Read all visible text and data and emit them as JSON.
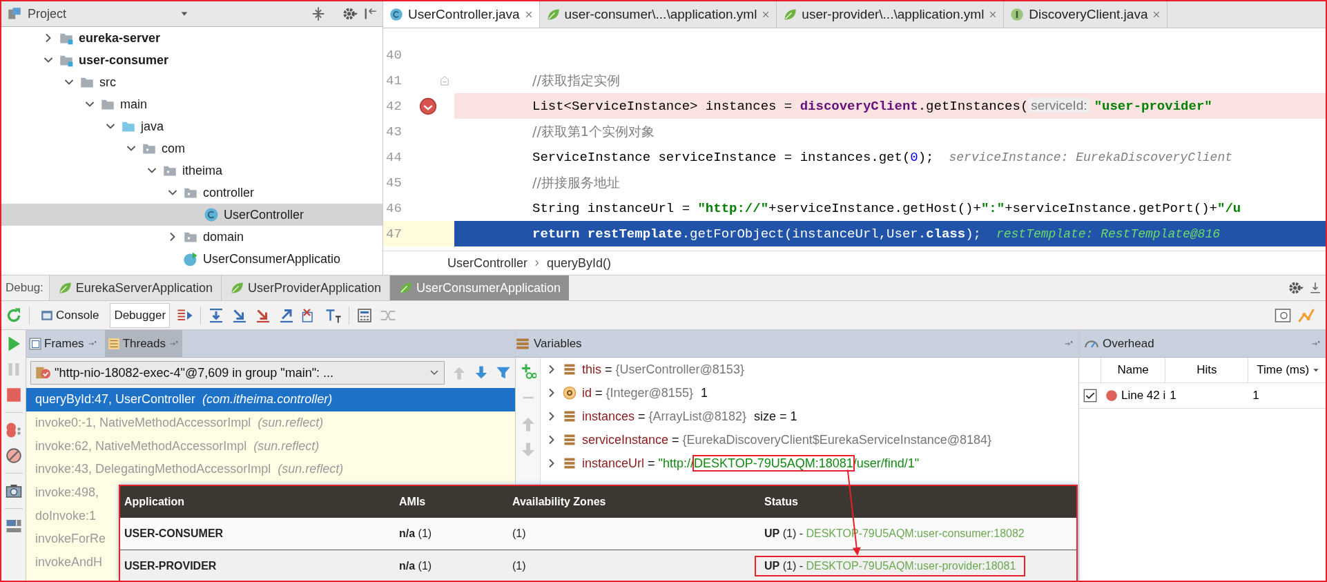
{
  "project": {
    "title": "Project",
    "tree": [
      {
        "label": "eureka-server",
        "kind": "module",
        "expanded": false,
        "selected": false
      },
      {
        "label": "user-consumer",
        "kind": "module",
        "expanded": true,
        "selected": false,
        "children": [
          {
            "label": "src",
            "kind": "folder",
            "expanded": true,
            "selected": false,
            "children": [
              {
                "label": "main",
                "kind": "folder",
                "expanded": true,
                "selected": false,
                "children": [
                  {
                    "label": "java",
                    "kind": "source_folder",
                    "expanded": true,
                    "selected": false,
                    "children": [
                      {
                        "label": "com",
                        "kind": "package",
                        "expanded": true,
                        "selected": false,
                        "children": [
                          {
                            "label": "itheima",
                            "kind": "package",
                            "expanded": true,
                            "selected": false,
                            "children": [
                              {
                                "label": "controller",
                                "kind": "package",
                                "expanded": true,
                                "selected": false,
                                "children": [
                                  {
                                    "label": "UserController",
                                    "kind": "class",
                                    "selected": true
                                  }
                                ]
                              },
                              {
                                "label": "domain",
                                "kind": "package",
                                "expanded": false,
                                "selected": false
                              },
                              {
                                "label": "UserConsumerApplicatio",
                                "kind": "main_class",
                                "selected": false
                              }
                            ]
                          }
                        ]
                      }
                    ]
                  }
                ]
              }
            ]
          }
        ]
      }
    ]
  },
  "editor": {
    "tabs": [
      {
        "label": "UserController.java",
        "kind": "class",
        "selected": true
      },
      {
        "label": "user-consumer\\...\\application.yml",
        "kind": "yml",
        "selected": false
      },
      {
        "label": "user-provider\\...\\application.yml",
        "kind": "yml",
        "selected": false
      },
      {
        "label": "DiscoveryClient.java",
        "kind": "interface",
        "selected": false
      }
    ],
    "lines": [
      {
        "number": "40",
        "kind": "normal"
      },
      {
        "number": "41",
        "kind": "normal",
        "tokens": [
          {
            "kind": "comment",
            "text": "//获取指定实例"
          }
        ]
      },
      {
        "number": "42",
        "kind": "breakpoint",
        "tokens": [
          {
            "kind": "plain",
            "text": "List<ServiceInstance> instances = "
          },
          {
            "kind": "field",
            "text": "discoveryClient"
          },
          {
            "kind": "plain",
            "text": ".getInstances("
          },
          {
            "kind": "hint",
            "text": "serviceId:"
          },
          {
            "kind": "string",
            "text": "\"user-provider\""
          }
        ]
      },
      {
        "number": "43",
        "kind": "normal",
        "tokens": [
          {
            "kind": "comment",
            "text": "//获取第1个实例对象"
          }
        ]
      },
      {
        "number": "44",
        "kind": "normal",
        "tokens": [
          {
            "kind": "plain",
            "text": "ServiceInstance serviceInstance = instances.get("
          },
          {
            "kind": "number",
            "text": "0"
          },
          {
            "kind": "plain",
            "text": ");"
          },
          {
            "kind": "inline_value",
            "text": "serviceInstance: EurekaDiscoveryClient"
          }
        ]
      },
      {
        "number": "45",
        "kind": "normal",
        "tokens": [
          {
            "kind": "comment",
            "text": "//拼接服务地址"
          }
        ]
      },
      {
        "number": "46",
        "kind": "normal",
        "tokens": [
          {
            "kind": "plain",
            "text": "String instanceUrl = "
          },
          {
            "kind": "string",
            "text": "\"http://\""
          },
          {
            "kind": "plain",
            "text": "+serviceInstance.getHost()+"
          },
          {
            "kind": "string",
            "text": "\":\""
          },
          {
            "kind": "plain",
            "text": "+serviceInstance.getPort()+"
          },
          {
            "kind": "string",
            "text": "\"/u"
          }
        ]
      },
      {
        "number": "47",
        "kind": "execution",
        "tokens": [
          {
            "kind": "keyword",
            "text": "return "
          },
          {
            "kind": "field",
            "text": "restTemplate"
          },
          {
            "kind": "plain",
            "text": ".getForObject(instanceUrl,User."
          },
          {
            "kind": "keyword",
            "text": "class"
          },
          {
            "kind": "plain",
            "text": ");"
          },
          {
            "kind": "inline_value",
            "text": "restTemplate: RestTemplate@816"
          }
        ]
      }
    ],
    "breadcrumb": [
      "UserController",
      "queryById()"
    ]
  },
  "debug": {
    "label": "Debug:",
    "run_tabs": [
      {
        "label": "EurekaServerApplication",
        "selected": false
      },
      {
        "label": "UserProviderApplication",
        "selected": false
      },
      {
        "label": "UserConsumerApplication",
        "selected": true
      }
    ],
    "view_tabs": [
      {
        "label": "Console",
        "kind": "console",
        "selected": false
      },
      {
        "label": "Debugger",
        "kind": "debugger",
        "selected": true
      }
    ],
    "frames": {
      "tabs": [
        {
          "label": "Frames",
          "selected": false
        },
        {
          "label": "Threads",
          "selected": true
        }
      ],
      "thread": "\"http-nio-18082-exec-4\"@7,609 in group \"main\": ...",
      "items": [
        {
          "method": "queryById:47, UserController",
          "package": "(com.itheima.controller)",
          "selected": true
        },
        {
          "method": "invoke0:-1, NativeMethodAccessorImpl",
          "package": "(sun.reflect)",
          "selected": false
        },
        {
          "method": "invoke:62, NativeMethodAccessorImpl",
          "package": "(sun.reflect)",
          "selected": false
        },
        {
          "method": "invoke:43, DelegatingMethodAccessorImpl",
          "package": "(sun.reflect)",
          "selected": false
        },
        {
          "method": "invoke:498,",
          "selected": false
        },
        {
          "method": "doInvoke:1",
          "selected": false
        },
        {
          "method": "invokeForRe",
          "selected": false
        },
        {
          "method": "invokeAndH",
          "selected": false
        }
      ]
    },
    "variables": {
      "title": "Variables",
      "items": [
        {
          "name": "this",
          "kind": "field",
          "expanded": false,
          "operator": "=",
          "value": "{UserController@8153}"
        },
        {
          "name": "id",
          "kind": "param",
          "expanded": false,
          "operator": "=",
          "value": "{Integer@8155}",
          "extra": "1"
        },
        {
          "name": "instances",
          "kind": "field",
          "expanded": false,
          "operator": "=",
          "value": "{ArrayList@8182}",
          "extra": "size = 1"
        },
        {
          "name": "serviceInstance",
          "kind": "field",
          "expanded": false,
          "operator": "=",
          "value": "{EurekaDiscoveryClient$EurekaServiceInstance@8184}"
        },
        {
          "name": "instanceUrl",
          "kind": "field",
          "expanded": false,
          "operator": "=",
          "value_parts": [
            {
              "text": "\"http://",
              "highlighted": false
            },
            {
              "text": "DESKTOP-79U5AQM:18081",
              "highlighted": true
            },
            {
              "text": "/user/find/1\"",
              "highlighted": false
            }
          ]
        }
      ]
    },
    "overhead": {
      "title": "Overhead",
      "columns": [
        "Name",
        "Hits",
        "Time (ms)"
      ],
      "rows": [
        {
          "checked": true,
          "name": "Line 42 i",
          "hits": "1",
          "time": "1"
        }
      ]
    }
  },
  "eureka": {
    "columns": [
      "Application",
      "AMIs",
      "Availability Zones",
      "Status"
    ],
    "rows": [
      {
        "application": "USER-CONSUMER",
        "amis": "**n/a** (1)",
        "zones": "(1)",
        "status": {
          "text": "**UP** (1) -",
          "link": "DESKTOP-79U5AQM:user-consumer:18082",
          "highlighted": false
        }
      },
      {
        "application": "USER-PROVIDER",
        "amis": "**n/a** (1)",
        "zones": "(1)",
        "status": {
          "text": "**UP** (1) -",
          "link": "DESKTOP-79U5AQM:user-provider:18081",
          "highlighted": true
        }
      }
    ]
  }
}
